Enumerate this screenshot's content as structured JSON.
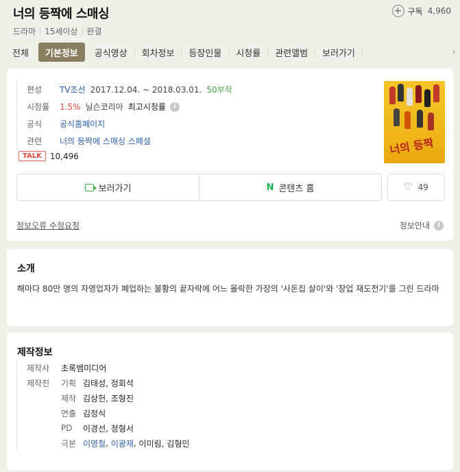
{
  "header": {
    "title": "너의 등짝에 스매싱",
    "subscribe_label": "구독",
    "subscribe_count": "4,960",
    "genre": "드라마",
    "rating": "15세이상",
    "status": "완결"
  },
  "tabs": [
    {
      "label": "전체"
    },
    {
      "label": "기본정보",
      "active": true
    },
    {
      "label": "공식영상"
    },
    {
      "label": "회차정보"
    },
    {
      "label": "등장인물"
    },
    {
      "label": "시청률"
    },
    {
      "label": "관련앨범"
    },
    {
      "label": "보러가기"
    }
  ],
  "info": {
    "broadcast_label": "편성",
    "channel": "TV조선",
    "period": "2017.12.04. ~ 2018.03.01.",
    "episodes": "50부작",
    "ratings_label": "시청률",
    "ratings_value": "1.5%",
    "ratings_source": "닐슨코리아",
    "ratings_note": "최고시청률",
    "official_label": "공식",
    "official_link": "공식홈페이지",
    "related_label": "관련",
    "related_link": "너의 등짝에 스매싱 스페셜",
    "talk_badge": "TALK",
    "talk_count": "10,496"
  },
  "actions": {
    "watch_label": "보러가기",
    "naver_label": "콘텐츠 홈",
    "naver_icon": "N",
    "like_count": "49"
  },
  "footer": {
    "report_label": "정보오류 수정요청",
    "guide_label": "정보안내"
  },
  "poster": {
    "title_text": "너의 등짝"
  },
  "intro": {
    "title": "소개",
    "text": "해마다 80만 명의 자영업자가 폐업하는 불황의 끝자락에 어느 몰락한 가장의 '사돈집 살이'와 '창업 재도전기'를 그린 드라마"
  },
  "production": {
    "title": "제작정보",
    "company_label": "제작사",
    "company": "초록뱀미디어",
    "staff_label": "제작진",
    "staff": [
      {
        "role": "기획",
        "names": "김태성, 정회석"
      },
      {
        "role": "제작",
        "names": "김상헌, 조형진"
      },
      {
        "role": "연출",
        "names": "김정식"
      },
      {
        "role": "PD",
        "names": "이경선, 정형서"
      }
    ],
    "writers_role": "극본",
    "writer_1": "이영철",
    "writer_2": "이광재",
    "writer_rest": "이미림, 김형민"
  },
  "colors": {
    "background": "#f0efe8",
    "active_tab": "#8a7e60",
    "link": "#2d5fa8",
    "green": "#4aa845",
    "red": "#e0463f"
  }
}
